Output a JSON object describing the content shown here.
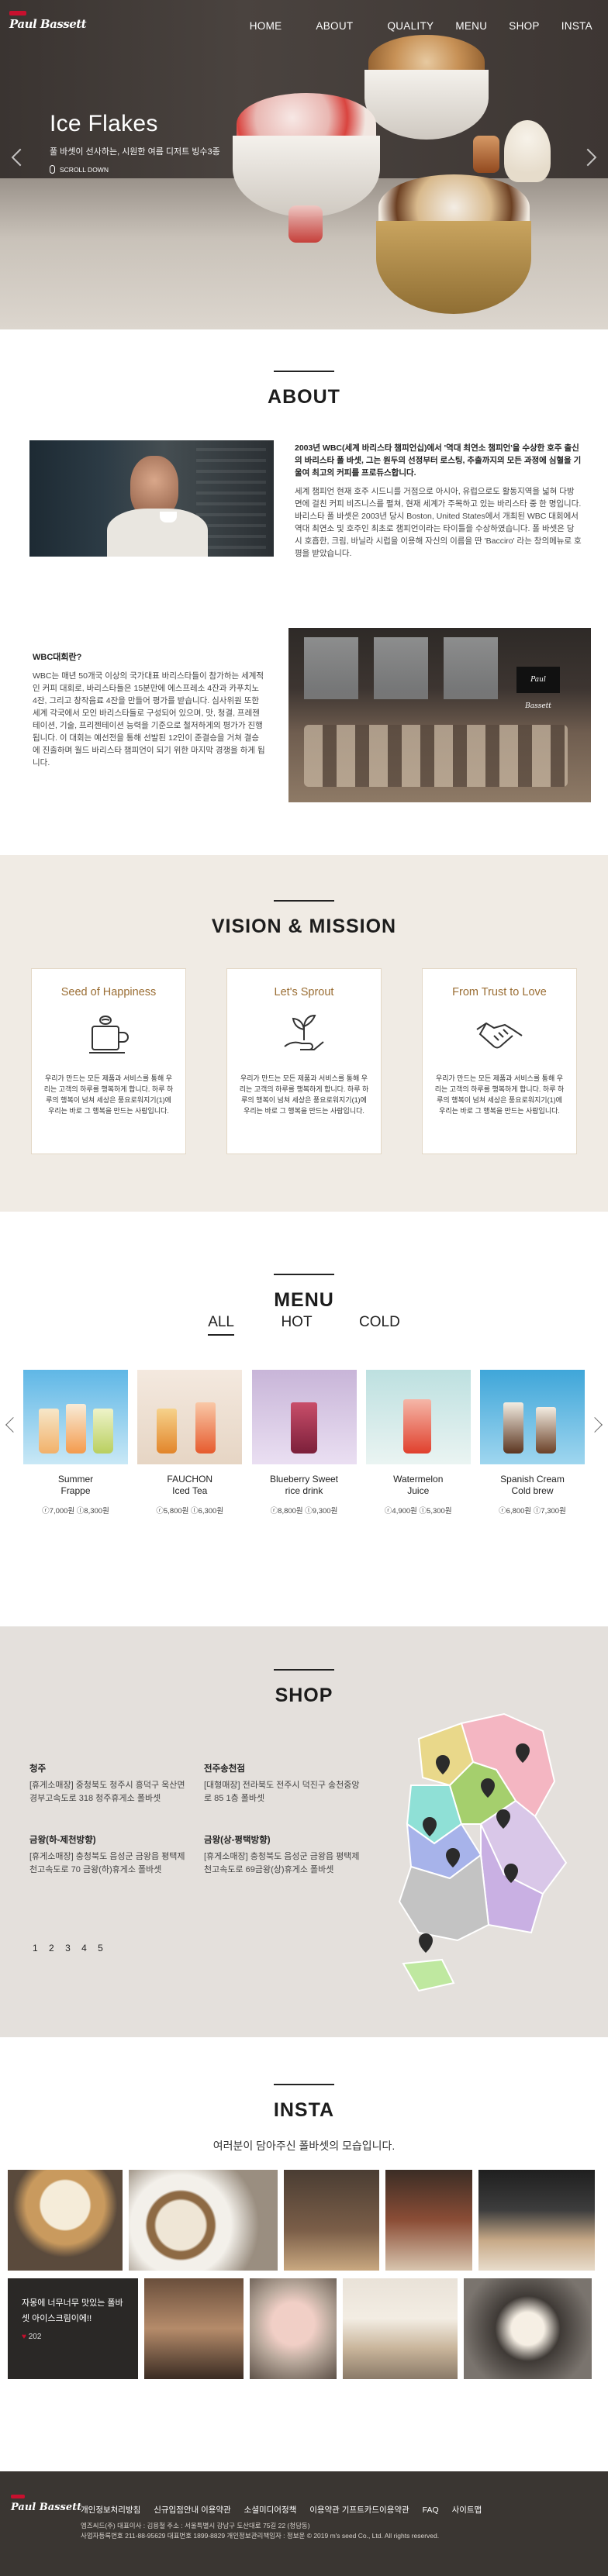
{
  "brand": {
    "logo_text": "Paul Bassett",
    "accent": "#c8102e"
  },
  "nav": {
    "items": [
      "HOME",
      "ABOUT",
      "QUALITY",
      "MENU",
      "SHOP",
      "INSTA"
    ]
  },
  "hero": {
    "title": "Ice Flakes",
    "subtitle": "풀 바셋이 선사하는, 시원한 여름 디저트 빙수3종",
    "scroll_label": "SCROLL DOWN"
  },
  "about": {
    "title": "ABOUT",
    "intro_strong": "2003년 WBC(세계 바리스타 챔피언십)에서 '역대 최연소 챔피언'을 수상한 호주 출신의 바리스타 폴 바셋, 그는 원두의 선정부터 로스팅, 추출까지의 모든 과정에 심혈을 기울여 최고의 커피를 프로듀스합니다.",
    "intro_body": "세계 챔피언 현재 호주 시드니를 거점으로 아시아, 유럽으로도 활동지역을 넓혀 다방면에 걸친 커피 비즈니스를 펼쳐, 현재 세계가 주목하고 있는 바리스타 중 한 명입니다. 바리스타 폴 바셋은 2003년 당시 Boston, United States에서 개최된 WBC 대회에서 역대 최연소 및 호주인 최초로 챔피언이라는 타이틀을 수상하였습니다. 폴 바셋은 당시 호흡한, 크림, 바닐라 시럽을 이용해 자신의 이름을 딴 'Bacciro' 라는 창의메뉴로 호평을 받았습니다.",
    "wbc_title": "WBC대회란?",
    "wbc_body": "WBC는 매년 50개국 이상의 국가대표 바리스타들이 참가하는 세계적인 커피 대회로, 바리스타들은 15분만에 에스프레소 4잔과 카푸치노 4잔, 그리고 창작음료 4잔을 만들어 평가를 받습니다. 심사위원 또한 세계 각국에서 모인 바리스타들로 구성되어 있으며, 맛, 청결, 프레젠테이션, 기술, 프리젠테이션 능력을 기준으로 철저하게의 평가가 진행됩니다. 이 대회는 예선전을 통해 선발된 12인이 준결승을 거쳐 결승에 진출하며 월드 바리스타 챔피언이 되기 위한 마지막 경쟁을 하게 됩니다."
  },
  "vision": {
    "title": "VISION & MISSION",
    "cards": [
      {
        "title": "Seed of Happiness",
        "icon": "coffee-bean-icon",
        "desc": "우리가 만드는 모든 제품과 서비스를 통해 우리는 고객의 하루를 행복하게 합니다. 하루 하루의 행복이 넘쳐 세상은 풍요로워지기(1)에 우리는 바로 그 행복을 만드는 사람입니다."
      },
      {
        "title": "Let's Sprout",
        "icon": "sprout-hand-icon",
        "desc": "우리가 만드는 모든 제품과 서비스를 통해 우리는 고객의 하루를 행복하게 합니다. 하루 하루의 행복이 넘쳐 세상은 풍요로워지기(1)에 우리는 바로 그 행복을 만드는 사람입니다."
      },
      {
        "title": "From Trust to Love",
        "icon": "handshake-icon",
        "desc": "우리가 만드는 모든 제품과 서비스를 통해 우리는 고객의 하루를 행복하게 합니다. 하루 하루의 행복이 넘쳐 세상은 풍요로워지기(1)에 우리는 바로 그 행복을 만드는 사람입니다."
      }
    ]
  },
  "menu": {
    "title": "MENU",
    "tabs": [
      "ALL",
      "HOT",
      "COLD"
    ],
    "active_tab": "ALL",
    "items": [
      {
        "name": "Summer\nFrappe",
        "price": "ⓡ7,000원 ⓛ8,300원"
      },
      {
        "name": "FAUCHON\nIced Tea",
        "price": "ⓡ5,800원 ⓛ6,300원"
      },
      {
        "name": "Blueberry Sweet\nrice drink",
        "price": "ⓡ8,800원 ⓛ9,300원"
      },
      {
        "name": "Watermelon\nJuice",
        "price": "ⓡ4,900원 ⓛ5,300원"
      },
      {
        "name": "Spanish Cream\nCold brew",
        "price": "ⓡ6,800원 ⓛ7,300원"
      }
    ]
  },
  "shop": {
    "title": "SHOP",
    "regions": [
      {
        "name": "청주",
        "text": "[휴게소매장] 중청북도 청주시 흥덕구 옥산면 경부고속도로 318 청주휴게소 폴바셋"
      },
      {
        "name": "전주송천점",
        "text": "[대형매장] 전라북도 전주시 덕진구 송천중앙로 85 1층 폴바셋"
      },
      {
        "name": "금왕(하-제천방향)",
        "text": "[휴게소매장] 충청북도 음성군 금왕읍 평택제천고속도로 70 금왕(하)휴게소 폴바셋"
      },
      {
        "name": "금왕(상-평택방향)",
        "text": "[휴게소매장] 충청북도 음성군 금왕읍 평택제천고속도로 69금왕(상)휴게소 폴바셋"
      }
    ],
    "pages": [
      "1",
      "2",
      "3",
      "4",
      "5"
    ]
  },
  "insta": {
    "title": "INSTA",
    "subtitle": "여러분이 담아주신 폴바셋의 모습입니다.",
    "caption_text": "자몽에 너무너무 맛있는 폴바셋 아이스크림이에!!",
    "caption_likes": "202"
  },
  "footer": {
    "links": [
      "개인정보처리방침",
      "신규입점안내 이용약관",
      "소셜미디어정책",
      "이용약관 기프트카드이용약관",
      "FAQ",
      "사이트맵"
    ],
    "info1": "엠즈씨드(주) 대표이사 : 김용철 주소 : 서울특별시 강남구 도산대로 75길 22 (청담동)",
    "info2": "사업자등록번호 211-88-95629 대표번호 1899-8829 개인정보관리책임자 : 정보운 © 2019 m's seed Co., Ltd. All rights reserved."
  }
}
